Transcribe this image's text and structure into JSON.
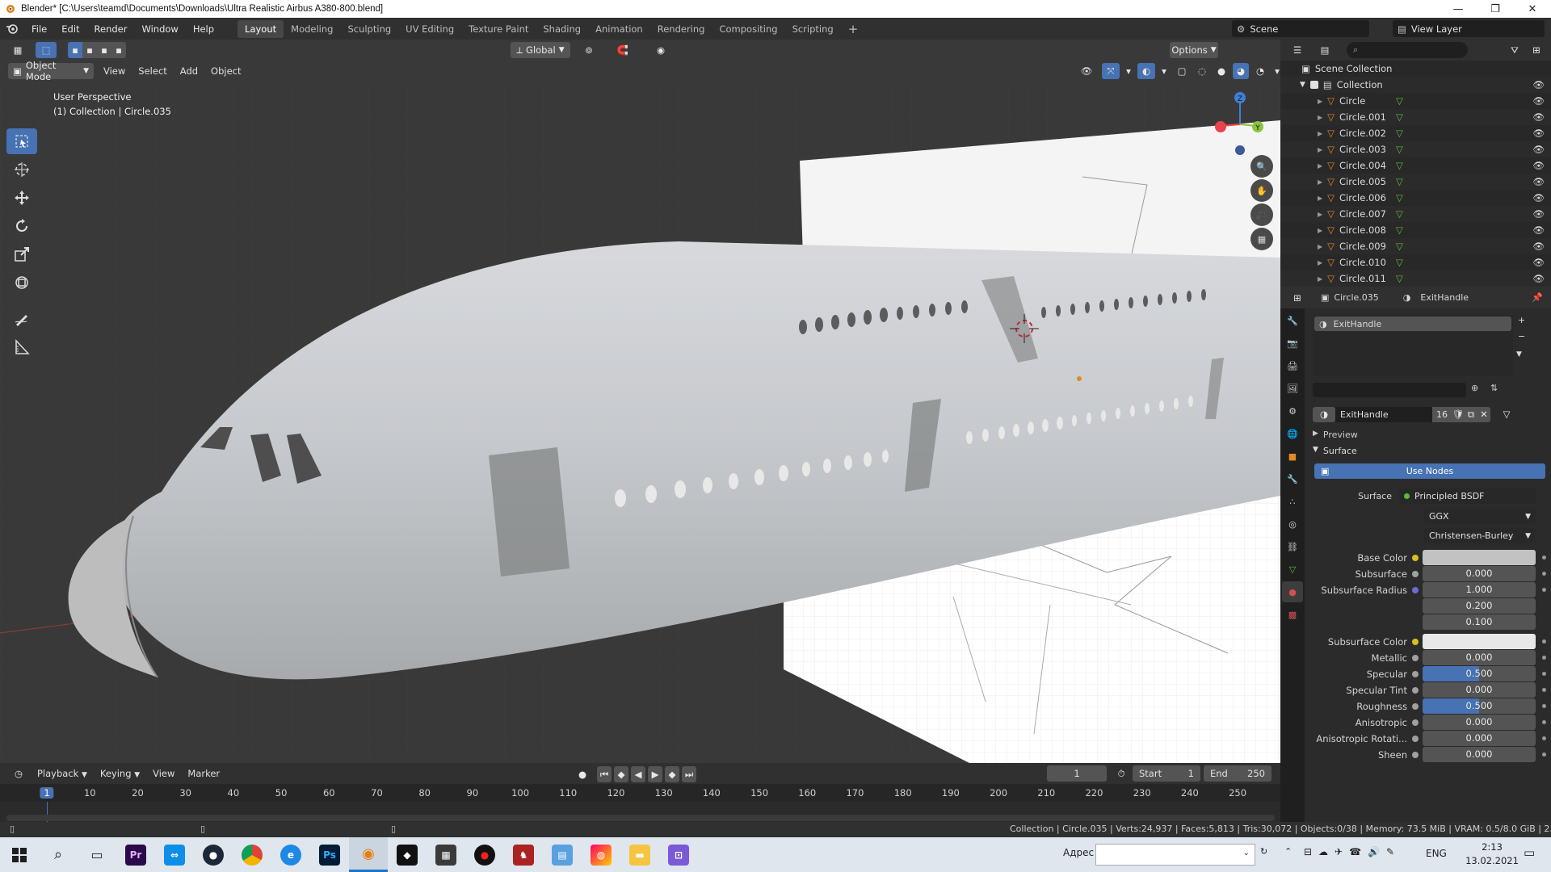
{
  "window": {
    "title": "Blender* [C:\\Users\\teamd\\Documents\\Downloads\\Ultra Realistic Airbus A380-800.blend]",
    "controls": [
      "—",
      "❐",
      "✕"
    ]
  },
  "menu": [
    "File",
    "Edit",
    "Render",
    "Window",
    "Help"
  ],
  "workspaces": {
    "active": "Layout",
    "tabs": [
      "Layout",
      "Modeling",
      "Sculpting",
      "UV Editing",
      "Texture Paint",
      "Shading",
      "Animation",
      "Rendering",
      "Compositing",
      "Scripting"
    ],
    "add": "+"
  },
  "scene": {
    "name": "Scene",
    "view_layer": "View Layer"
  },
  "viewport": {
    "transform_orientation": "Global",
    "options": "Options",
    "mode": "Object Mode",
    "header_menu": [
      "View",
      "Select",
      "Add",
      "Object"
    ],
    "info_line1": "User Perspective",
    "info_line2": "(1) Collection | Circle.035",
    "gizmo_axes": {
      "z": "Z",
      "y": "Y",
      "x": "X"
    },
    "colors": {
      "background": "#393939",
      "x_axis": "#e8434c",
      "y_axis": "#8bc43d",
      "z_axis": "#3f7fdc"
    }
  },
  "tools": [
    "select-box-icon",
    "cursor-icon",
    "move-icon",
    "rotate-icon",
    "scale-icon",
    "transform-icon",
    "annotate-icon",
    "measure-icon"
  ],
  "timeline": {
    "menu": [
      "Playback",
      "Keying",
      "View",
      "Marker"
    ],
    "current_frame": "1",
    "start_label": "Start",
    "start": "1",
    "end_label": "End",
    "end": "250",
    "ruler": [
      "1",
      "10",
      "20",
      "30",
      "40",
      "50",
      "60",
      "70",
      "80",
      "90",
      "100",
      "110",
      "120",
      "130",
      "140",
      "150",
      "160",
      "170",
      "180",
      "190",
      "200",
      "210",
      "220",
      "230",
      "240",
      "250"
    ]
  },
  "status": {
    "text": "Collection | Circle.035 | Verts:24,937 | Faces:5,813 | Tris:30,072 | Objects:0/38 | Memory: 73.5 MiB | VRAM: 0.5/8.0 GiB | 2.90.1"
  },
  "outliner": {
    "root": "Scene Collection",
    "collection": "Collection",
    "items": [
      "Circle",
      "Circle.001",
      "Circle.002",
      "Circle.003",
      "Circle.004",
      "Circle.005",
      "Circle.006",
      "Circle.007",
      "Circle.008",
      "Circle.009",
      "Circle.010",
      "Circle.011"
    ]
  },
  "properties": {
    "object": "Circle.035",
    "material": "ExitHandle",
    "slot": "ExitHandle",
    "datablock": "ExitHandle",
    "users": "16",
    "sections": {
      "preview": "Preview",
      "surface": "Surface"
    },
    "use_nodes": "Use Nodes",
    "surface_label": "Surface",
    "surface_value": "Principled BSDF",
    "distribution": "GGX",
    "subsurface_method": "Christensen-Burley",
    "fields": [
      {
        "label": "Base Color",
        "value": "",
        "type": "color",
        "color": "#c2c2c2",
        "dot": "#d6c21e"
      },
      {
        "label": "Subsurface",
        "value": "0.000",
        "type": "num",
        "dot": "#a0a0a0"
      },
      {
        "label": "Subsurface Radius",
        "value": "1.000",
        "type": "num",
        "dot": "#6b6bd6"
      },
      {
        "label": "",
        "value": "0.200",
        "type": "num",
        "dot": ""
      },
      {
        "label": "",
        "value": "0.100",
        "type": "num",
        "dot": ""
      },
      {
        "label": "Subsurface Color",
        "value": "",
        "type": "color",
        "color": "#e8e8e8",
        "dot": "#d6c21e"
      },
      {
        "label": "Metallic",
        "value": "0.000",
        "type": "num",
        "dot": "#a0a0a0"
      },
      {
        "label": "Specular",
        "value": "0.500",
        "type": "slider",
        "dot": "#a0a0a0"
      },
      {
        "label": "Specular Tint",
        "value": "0.000",
        "type": "num",
        "dot": "#a0a0a0"
      },
      {
        "label": "Roughness",
        "value": "0.500",
        "type": "slider",
        "dot": "#a0a0a0"
      },
      {
        "label": "Anisotropic",
        "value": "0.000",
        "type": "num",
        "dot": "#a0a0a0"
      },
      {
        "label": "Anisotropic Rotati...",
        "value": "0.000",
        "type": "num",
        "dot": "#a0a0a0"
      },
      {
        "label": "Sheen",
        "value": "0.000",
        "type": "num",
        "dot": "#a0a0a0"
      }
    ]
  },
  "taskbar": {
    "address_label": "Адрес",
    "lang": "ENG",
    "time": "2:13",
    "date": "13.02.2021",
    "apps": [
      "Pr",
      "Ps"
    ]
  }
}
